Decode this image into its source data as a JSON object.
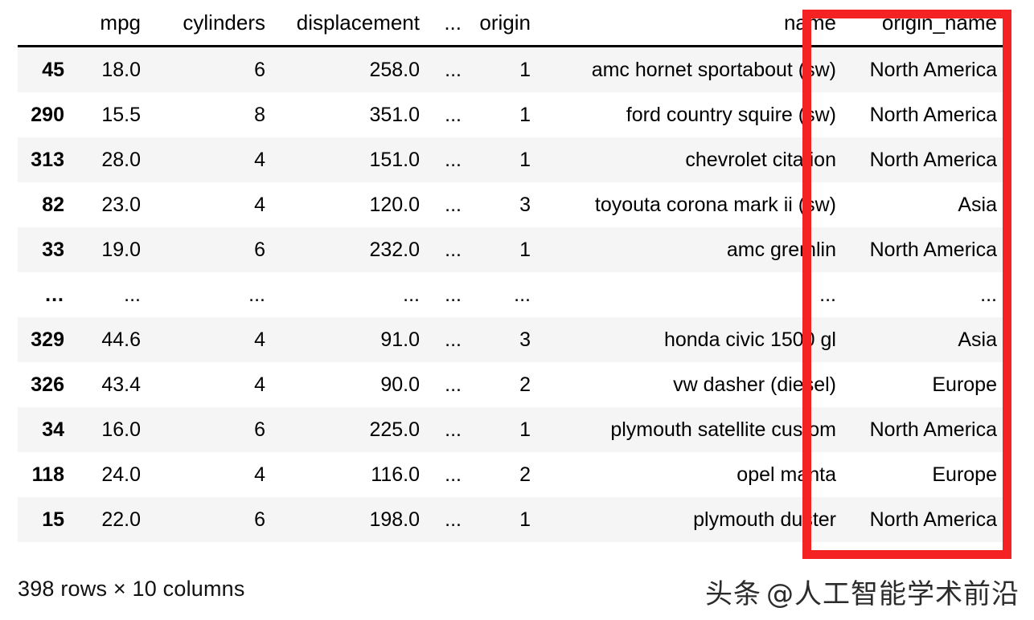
{
  "table": {
    "index_header": "",
    "columns": [
      "mpg",
      "cylinders",
      "displacement",
      "...",
      "origin",
      "name",
      "origin_name"
    ],
    "highlighted_column": "origin_name",
    "rows": [
      {
        "index": "45",
        "mpg": "18.0",
        "cylinders": "6",
        "displacement": "258.0",
        "ellipsis": "...",
        "origin": "1",
        "name": "amc hornet sportabout (sw)",
        "origin_name": "North America"
      },
      {
        "index": "290",
        "mpg": "15.5",
        "cylinders": "8",
        "displacement": "351.0",
        "ellipsis": "...",
        "origin": "1",
        "name": "ford country squire (sw)",
        "origin_name": "North America"
      },
      {
        "index": "313",
        "mpg": "28.0",
        "cylinders": "4",
        "displacement": "151.0",
        "ellipsis": "...",
        "origin": "1",
        "name": "chevrolet citation",
        "origin_name": "North America"
      },
      {
        "index": "82",
        "mpg": "23.0",
        "cylinders": "4",
        "displacement": "120.0",
        "ellipsis": "...",
        "origin": "3",
        "name": "toyouta corona mark ii (sw)",
        "origin_name": "Asia"
      },
      {
        "index": "33",
        "mpg": "19.0",
        "cylinders": "6",
        "displacement": "232.0",
        "ellipsis": "...",
        "origin": "1",
        "name": "amc gremlin",
        "origin_name": "North America"
      },
      {
        "index": "...",
        "mpg": "...",
        "cylinders": "...",
        "displacement": "...",
        "ellipsis": "...",
        "origin": "...",
        "name": "...",
        "origin_name": "..."
      },
      {
        "index": "329",
        "mpg": "44.6",
        "cylinders": "4",
        "displacement": "91.0",
        "ellipsis": "...",
        "origin": "3",
        "name": "honda civic 1500 gl",
        "origin_name": "Asia"
      },
      {
        "index": "326",
        "mpg": "43.4",
        "cylinders": "4",
        "displacement": "90.0",
        "ellipsis": "...",
        "origin": "2",
        "name": "vw dasher (diesel)",
        "origin_name": "Europe"
      },
      {
        "index": "34",
        "mpg": "16.0",
        "cylinders": "6",
        "displacement": "225.0",
        "ellipsis": "...",
        "origin": "1",
        "name": "plymouth satellite custom",
        "origin_name": "North America"
      },
      {
        "index": "118",
        "mpg": "24.0",
        "cylinders": "4",
        "displacement": "116.0",
        "ellipsis": "...",
        "origin": "2",
        "name": "opel manta",
        "origin_name": "Europe"
      },
      {
        "index": "15",
        "mpg": "22.0",
        "cylinders": "6",
        "displacement": "198.0",
        "ellipsis": "...",
        "origin": "1",
        "name": "plymouth duster",
        "origin_name": "North America"
      }
    ]
  },
  "footer": {
    "shape_text": "398 rows × 10 columns"
  },
  "watermark": {
    "tag": "头条",
    "handle": "@人工智能学术前沿"
  },
  "colors": {
    "highlight": "#f42222",
    "row_stripe": "#f5f5f5",
    "row_plain": "#ffffff",
    "text": "#000000"
  }
}
